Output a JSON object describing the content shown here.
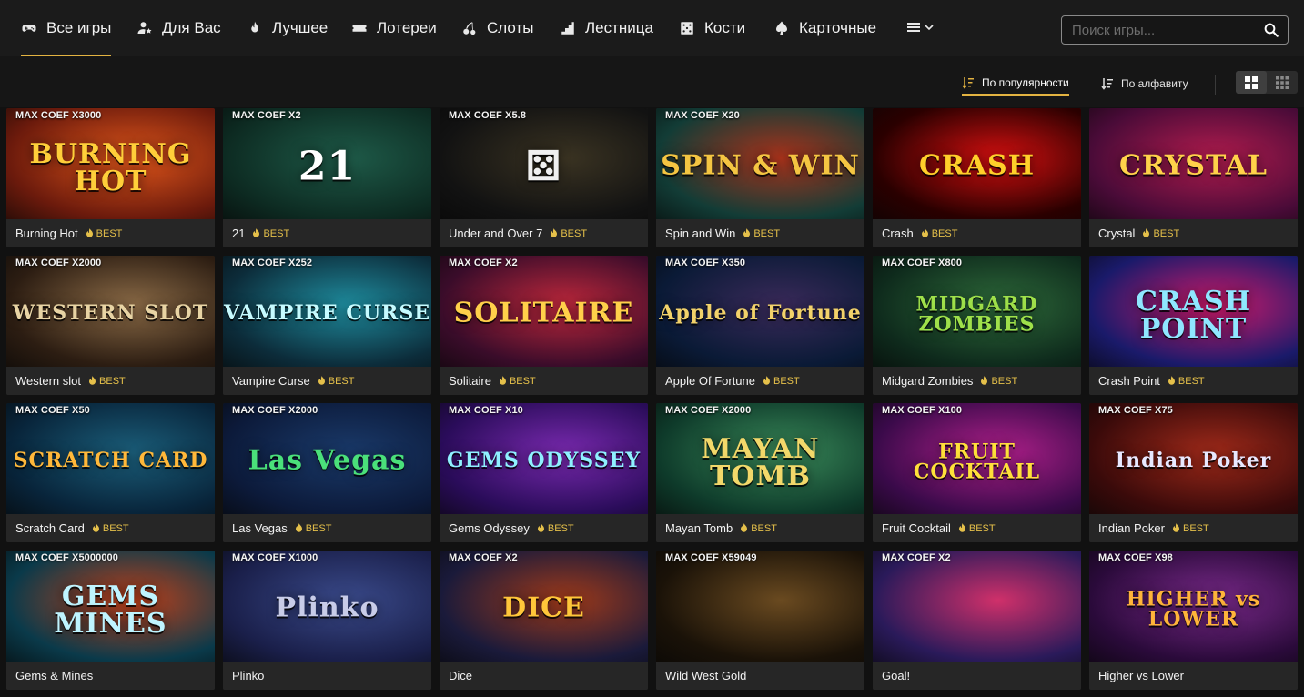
{
  "nav": {
    "items": [
      {
        "label": "Все игры",
        "icon": "gamepad-icon",
        "active": true
      },
      {
        "label": "Для Вас",
        "icon": "user-star-icon",
        "active": false
      },
      {
        "label": "Лучшее",
        "icon": "flame-icon",
        "active": false
      },
      {
        "label": "Лотереи",
        "icon": "ticket-icon",
        "active": false
      },
      {
        "label": "Слоты",
        "icon": "cherry-icon",
        "active": false
      },
      {
        "label": "Лестница",
        "icon": "stairs-icon",
        "active": false
      },
      {
        "label": "Кости",
        "icon": "dice-icon",
        "active": false
      },
      {
        "label": "Карточные",
        "icon": "spade-icon",
        "active": false
      }
    ],
    "more_icon": "hamburger-menu-icon"
  },
  "search": {
    "placeholder": "Поиск игры...",
    "value": "",
    "icon": "search-icon"
  },
  "sort": {
    "popularity_label": "По популярности",
    "alphabet_label": "По алфавиту",
    "active": "popularity"
  },
  "view_toggle": {
    "options": [
      "large-grid-icon",
      "small-grid-icon"
    ],
    "active": "large-grid-icon"
  },
  "best_label": "BEST",
  "colors": {
    "accent": "#e3b341",
    "background": "#111111",
    "card": "#262626"
  },
  "games": [
    {
      "coef": "MAX COEF X3000",
      "name": "Burning Hot",
      "best": true,
      "logo": "BURNING HOT",
      "c1": "#6b1a0c",
      "c2": "#e0561b",
      "lc": "#ffcf3a"
    },
    {
      "coef": "MAX COEF X2",
      "name": "21",
      "best": true,
      "logo": "21",
      "c1": "#0d2b22",
      "c2": "#1e5a48",
      "lc": "#ffffff"
    },
    {
      "coef": "MAX COEF X5.8",
      "name": "Under and Over 7",
      "best": true,
      "logo": "⚄",
      "c1": "#121212",
      "c2": "#3a3322",
      "lc": "#f0f0f0"
    },
    {
      "coef": "MAX COEF X20",
      "name": "Spin and Win",
      "best": true,
      "logo": "SPIN & WIN",
      "c1": "#123c36",
      "c2": "#a8321b",
      "lc": "#f4c542"
    },
    {
      "coef": "",
      "name": "Crash",
      "best": true,
      "logo": "CRASH",
      "c1": "#2a0000",
      "c2": "#d41010",
      "lc": "#ffcf2a"
    },
    {
      "coef": "",
      "name": "Crystal",
      "best": true,
      "logo": "CRYSTAL",
      "c1": "#4a0b38",
      "c2": "#b21c4e",
      "lc": "#ffd24a"
    },
    {
      "coef": "MAX COEF X2000",
      "name": "Western slot",
      "best": true,
      "logo": "WESTERN SLOT",
      "c1": "#2c1d12",
      "c2": "#8a6a46",
      "lc": "#e8d4a4"
    },
    {
      "coef": "MAX COEF X252",
      "name": "Vampire Curse",
      "best": true,
      "logo": "VAMPIRE CURSE",
      "c1": "#0c2c3a",
      "c2": "#1f8c9e",
      "lc": "#c6fbff"
    },
    {
      "coef": "MAX COEF X2",
      "name": "Solitaire",
      "best": true,
      "logo": "SOLITAIRE",
      "c1": "#3a0c2a",
      "c2": "#c0283c",
      "lc": "#ffd04a"
    },
    {
      "coef": "MAX COEF X350",
      "name": "Apple Of Fortune",
      "best": true,
      "logo": "Apple of Fortune",
      "c1": "#0a1a36",
      "c2": "#3a2a5a",
      "lc": "#f2d26a"
    },
    {
      "coef": "MAX COEF X800",
      "name": "Midgard Zombies",
      "best": true,
      "logo": "MIDGARD ZOMBIES",
      "c1": "#0e2a1c",
      "c2": "#2e6a3a",
      "lc": "#9fe04a"
    },
    {
      "coef": "",
      "name": "Crash Point",
      "best": true,
      "logo": "CRASH POINT",
      "c1": "#1a1a6a",
      "c2": "#d01a6a",
      "lc": "#8fe7ff"
    },
    {
      "coef": "MAX COEF X50",
      "name": "Scratch Card",
      "best": true,
      "logo": "SCRATCH CARD",
      "c1": "#08243a",
      "c2": "#1b5e7a",
      "lc": "#ffb83a"
    },
    {
      "coef": "MAX COEF X2000",
      "name": "Las Vegas",
      "best": true,
      "logo": "Las Vegas",
      "c1": "#0c1a3a",
      "c2": "#1a3a6a",
      "lc": "#4ae07a"
    },
    {
      "coef": "MAX COEF X10",
      "name": "Gems Odyssey",
      "best": true,
      "logo": "GEMS ODYSSEY",
      "c1": "#2a0c5a",
      "c2": "#7a2ab0",
      "lc": "#8ff0ff"
    },
    {
      "coef": "MAX COEF X2000",
      "name": "Mayan Tomb",
      "best": true,
      "logo": "MAYAN TOMB",
      "c1": "#0e3a2a",
      "c2": "#3a8a5a",
      "lc": "#f2d86a"
    },
    {
      "coef": "MAX COEF X100",
      "name": "Fruit Cocktail",
      "best": true,
      "logo": "FRUIT COCKTAIL",
      "c1": "#3a0a4a",
      "c2": "#b0208a",
      "lc": "#ffe03a"
    },
    {
      "coef": "MAX COEF X75",
      "name": "Indian Poker",
      "best": true,
      "logo": "Indian Poker",
      "c1": "#3a0a0a",
      "c2": "#a02a1a",
      "lc": "#e8e8ff"
    },
    {
      "coef": "MAX COEF X5000000",
      "name": "Gems & Mines",
      "best": false,
      "logo": "GEMS MINES",
      "c1": "#0a3a4a",
      "c2": "#c0401a",
      "lc": "#bff4ff"
    },
    {
      "coef": "MAX COEF X1000",
      "name": "Plinko",
      "best": false,
      "logo": "Plinko",
      "c1": "#1a1f4a",
      "c2": "#3a4a8a",
      "lc": "#c8cce8"
    },
    {
      "coef": "MAX COEF X2",
      "name": "Dice",
      "best": false,
      "logo": "DICE",
      "c1": "#1a1a3a",
      "c2": "#a03a1a",
      "lc": "#ffc63a"
    },
    {
      "coef": "MAX COEF X59049",
      "name": "Wild West Gold",
      "best": false,
      "logo": "",
      "c1": "#1a1208",
      "c2": "#6a4a20",
      "lc": "#e0b04a"
    },
    {
      "coef": "MAX COEF X2",
      "name": "Goal!",
      "best": false,
      "logo": "",
      "c1": "#2a1a5a",
      "c2": "#d0306a",
      "lc": "#ffffff"
    },
    {
      "coef": "MAX COEF X98",
      "name": "Higher vs Lower",
      "best": false,
      "logo": "HIGHER vs LOWER",
      "c1": "#2a0a3a",
      "c2": "#7a2a8a",
      "lc": "#ffb43a"
    }
  ]
}
